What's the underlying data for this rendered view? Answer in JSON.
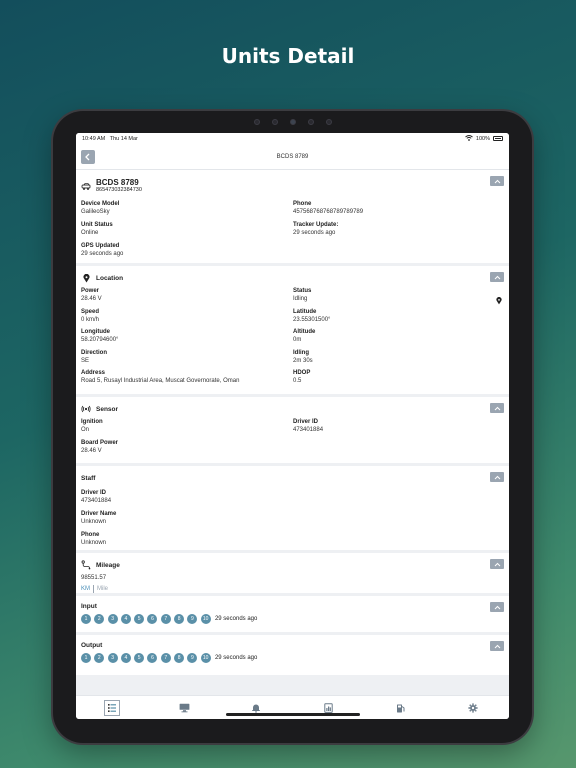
{
  "promo_title": "Units Detail",
  "status_bar": {
    "time": "10:49 AM",
    "date": "Thu 14 Mar",
    "battery": "100%"
  },
  "nav": {
    "title": "BCDS 8789",
    "back_icon": "chevron-left-icon"
  },
  "unit_card": {
    "name": "BCDS 8789",
    "imei": "865473032384730",
    "fields": [
      {
        "label": "Device Model",
        "value": "GalileoSky"
      },
      {
        "label": "Phone",
        "value": "457568768768789789789"
      },
      {
        "label": "Unit Status",
        "value": "Online"
      },
      {
        "label": "Tracker Update:",
        "value": "29 seconds ago"
      },
      {
        "label": "GPS Updated",
        "value": "29 seconds ago"
      }
    ]
  },
  "location_card": {
    "title": "Location",
    "fields": [
      {
        "label": "Power",
        "value": "28.46 V"
      },
      {
        "label": "Status",
        "value": "Idling"
      },
      {
        "label": "Speed",
        "value": "0 km/h"
      },
      {
        "label": "Latitude",
        "value": "23.55301500°"
      },
      {
        "label": "Longitude",
        "value": "58.20794600°"
      },
      {
        "label": "Altitude",
        "value": "0m"
      },
      {
        "label": "Direction",
        "value": "SE"
      },
      {
        "label": "Idling",
        "value": "2m 30s"
      },
      {
        "label": "Address",
        "value": "Road 5, Rusayl Industrial Area, Muscat Governorate, Oman"
      },
      {
        "label": "HDOP",
        "value": "0.5"
      }
    ]
  },
  "sensor_card": {
    "title": "Sensor",
    "fields": [
      {
        "label": "Ignition",
        "value": "On"
      },
      {
        "label": "Driver ID",
        "value": "473401884"
      },
      {
        "label": "Board Power",
        "value": "28.46 V"
      }
    ]
  },
  "staff_card": {
    "title": "Staff",
    "fields": [
      {
        "label": "Driver ID",
        "value": "473401884"
      },
      {
        "label": "Driver Name",
        "value": "Unknown"
      },
      {
        "label": "Phone",
        "value": "Unknown"
      }
    ]
  },
  "mileage_card": {
    "title": "Mileage",
    "value": "98551.57",
    "unit_km": "KM",
    "unit_mile": "Mile",
    "selected_unit": "KM"
  },
  "input_card": {
    "title": "Input",
    "channels": [
      "1",
      "2",
      "3",
      "4",
      "5",
      "6",
      "7",
      "8",
      "9",
      "10"
    ],
    "updated": "29 seconds ago"
  },
  "output_card": {
    "title": "Output",
    "channels": [
      "1",
      "2",
      "3",
      "4",
      "5",
      "6",
      "7",
      "8",
      "9",
      "10"
    ],
    "updated": "29 seconds ago"
  },
  "tabbar": {
    "items": [
      "list-icon",
      "monitor-icon",
      "notification-icon",
      "report-icon",
      "fuel-icon",
      "settings-icon"
    ],
    "active": 0
  },
  "colors": {
    "accent": "#5a90a8",
    "button_gray": "#9aa5b1",
    "link_blue": "#4b8fb8"
  }
}
